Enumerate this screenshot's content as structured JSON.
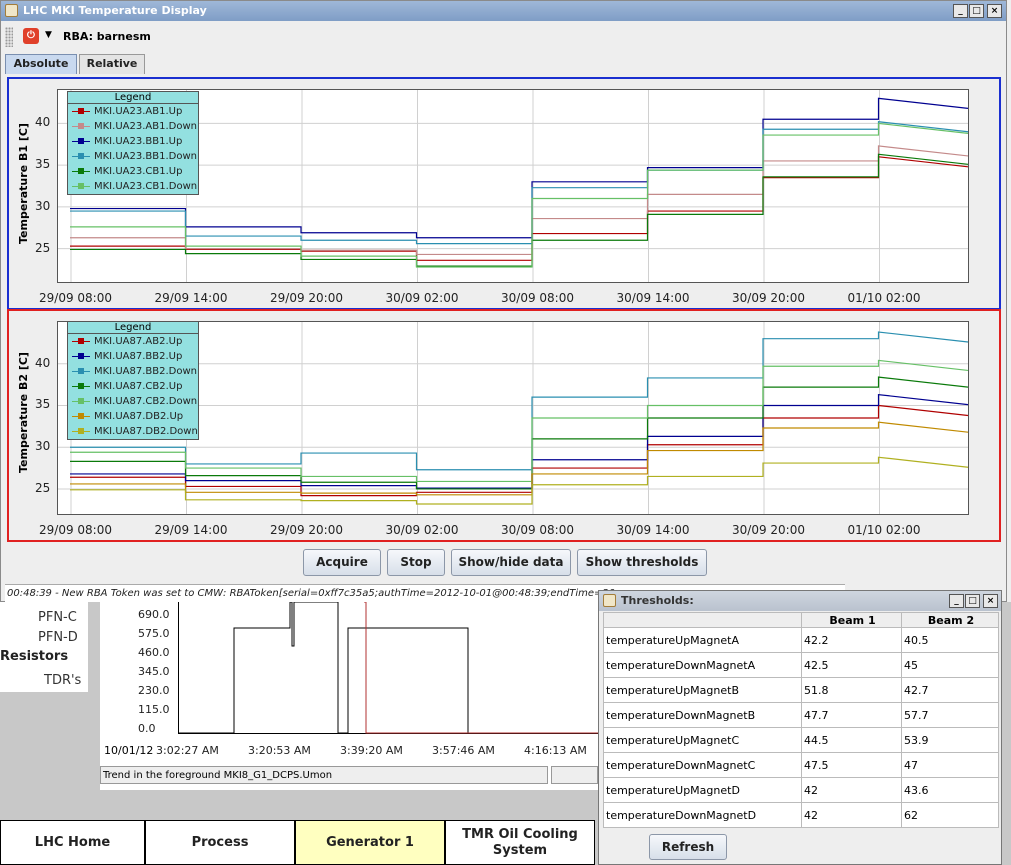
{
  "window": {
    "title": "LHC MKI Temperature Display"
  },
  "toolbar": {
    "rba_label": "RBA: barnesm"
  },
  "tabs": [
    {
      "label": "Absolute"
    },
    {
      "label": "Relative"
    }
  ],
  "charts": [
    {
      "ylabel": "Temperature B1  [C]",
      "yticks": [
        "40",
        "35",
        "30",
        "25"
      ],
      "xticks": [
        "29/09 08:00",
        "29/09 14:00",
        "29/09 20:00",
        "30/09 02:00",
        "30/09 08:00",
        "30/09 14:00",
        "30/09 20:00",
        "01/10 02:00"
      ],
      "legend_title": "Legend",
      "legend": [
        {
          "name": "MKI.UA23.AB1.Up",
          "color": "#b00000"
        },
        {
          "name": "MKI.UA23.AB1.Down",
          "color": "#c48a8a"
        },
        {
          "name": "MKI.UA23.BB1.Up",
          "color": "#000090"
        },
        {
          "name": "MKI.UA23.BB1.Down",
          "color": "#2a8fb0"
        },
        {
          "name": "MKI.UA23.CB1.Up",
          "color": "#0a7a0a"
        },
        {
          "name": "MKI.UA23.CB1.Down",
          "color": "#66c066"
        }
      ]
    },
    {
      "ylabel": "Temperature B2  [C]",
      "yticks": [
        "40",
        "35",
        "30",
        "25"
      ],
      "xticks": [
        "29/09 08:00",
        "29/09 14:00",
        "29/09 20:00",
        "30/09 02:00",
        "30/09 08:00",
        "30/09 14:00",
        "30/09 20:00",
        "01/10 02:00"
      ],
      "legend_title": "Legend",
      "legend": [
        {
          "name": "MKI.UA87.AB2.Up",
          "color": "#b00000"
        },
        {
          "name": "MKI.UA87.BB2.Up",
          "color": "#000090"
        },
        {
          "name": "MKI.UA87.BB2.Down",
          "color": "#2a8fb0"
        },
        {
          "name": "MKI.UA87.CB2.Up",
          "color": "#0a7a0a"
        },
        {
          "name": "MKI.UA87.CB2.Down",
          "color": "#66c066"
        },
        {
          "name": "MKI.UA87.DB2.Up",
          "color": "#c08a00"
        },
        {
          "name": "MKI.UA87.DB2.Down",
          "color": "#b0b020"
        }
      ]
    }
  ],
  "chart_data": [
    {
      "type": "line",
      "ylabel": "Temperature B1  [C]",
      "ylim": [
        21,
        44
      ],
      "x": [
        "29/09 08:00",
        "29/09 14:00",
        "29/09 20:00",
        "30/09 02:00",
        "30/09 08:00",
        "30/09 14:00",
        "30/09 20:00",
        "01/10 02:00"
      ],
      "series": [
        {
          "name": "MKI.UA23.AB1.Up",
          "values": [
            25.3,
            24.9,
            24.7,
            23.6,
            26.8,
            29.5,
            33.5,
            36.0
          ]
        },
        {
          "name": "MKI.UA23.AB1.Down",
          "values": [
            26.3,
            25.0,
            24.8,
            24.3,
            28.6,
            31.5,
            35.5,
            37.3
          ]
        },
        {
          "name": "MKI.UA23.BB1.Up",
          "values": [
            29.8,
            27.6,
            26.9,
            26.3,
            33.0,
            34.7,
            40.5,
            43.0
          ]
        },
        {
          "name": "MKI.UA23.BB1.Down",
          "values": [
            29.5,
            26.5,
            26.0,
            25.6,
            32.3,
            34.4,
            39.3,
            40.2
          ]
        },
        {
          "name": "MKI.UA23.CB1.Up",
          "values": [
            24.9,
            24.4,
            23.7,
            22.9,
            26.0,
            29.1,
            33.6,
            36.3
          ]
        },
        {
          "name": "MKI.UA23.CB1.Down",
          "values": [
            27.6,
            25.3,
            24.1,
            22.8,
            31.0,
            34.4,
            38.6,
            40.0
          ]
        }
      ]
    },
    {
      "type": "line",
      "ylabel": "Temperature B2  [C]",
      "ylim": [
        22,
        45
      ],
      "x": [
        "29/09 08:00",
        "29/09 14:00",
        "29/09 20:00",
        "30/09 02:00",
        "30/09 08:00",
        "30/09 14:00",
        "30/09 20:00",
        "01/10 02:00"
      ],
      "series": [
        {
          "name": "MKI.UA87.AB2.Up",
          "values": [
            26.4,
            25.3,
            24.2,
            24.6,
            27.5,
            30.3,
            33.5,
            35.0
          ]
        },
        {
          "name": "MKI.UA87.BB2.Up",
          "values": [
            26.8,
            26.0,
            25.4,
            25.1,
            28.5,
            31.3,
            35.0,
            36.3
          ]
        },
        {
          "name": "MKI.UA87.BB2.Down",
          "values": [
            30.0,
            28.0,
            29.3,
            27.3,
            36.0,
            38.3,
            43.0,
            43.8
          ]
        },
        {
          "name": "MKI.UA87.CB2.Up",
          "values": [
            28.3,
            26.6,
            25.8,
            25.0,
            31.0,
            33.5,
            37.2,
            38.4
          ]
        },
        {
          "name": "MKI.UA87.CB2.Down",
          "values": [
            29.4,
            27.5,
            26.5,
            25.9,
            33.5,
            35.0,
            39.7,
            40.4
          ]
        },
        {
          "name": "MKI.UA87.DB2.Up",
          "values": [
            25.6,
            24.6,
            24.5,
            24.3,
            26.8,
            29.6,
            32.3,
            33.0
          ]
        },
        {
          "name": "MKI.UA87.DB2.Down",
          "values": [
            24.9,
            23.7,
            23.6,
            23.2,
            25.5,
            26.5,
            28.1,
            28.8
          ]
        }
      ]
    }
  ],
  "buttons": {
    "acquire": "Acquire",
    "stop": "Stop",
    "show_hide": "Show/hide data",
    "show_thresholds": "Show thresholds"
  },
  "status": "00:48:39 - New RBA Token was set to CMW: RBAToken[serial=0xff7c35a5;authTime=2012-10-01@00:48:39;endTime=20",
  "background": {
    "labels": [
      "PFN-C",
      "PFN-D",
      "Resistors",
      "TDR's"
    ],
    "trend_yticks": [
      "690.0",
      "575.0",
      "460.0",
      "345.0",
      "230.0",
      "115.0",
      "0.0"
    ],
    "trend_date": "10/01/12",
    "trend_xticks": [
      "3:02:27 AM",
      "3:20:53 AM",
      "3:39:20 AM",
      "3:57:46 AM",
      "4:16:13 AM"
    ],
    "trend_caption": "Trend in the foreground MKI8_G1_DCPS.Umon",
    "nav": [
      "LHC Home",
      "Process",
      "Generator 1",
      "TMR Oil Cooling System"
    ]
  },
  "thresholds": {
    "title": "Thresholds:",
    "columns": [
      "",
      "Beam 1",
      "Beam 2"
    ],
    "rows": [
      [
        "temperatureUpMagnetA",
        "42.2",
        "40.5"
      ],
      [
        "temperatureDownMagnetA",
        "42.5",
        "45"
      ],
      [
        "temperatureUpMagnetB",
        "51.8",
        "42.7"
      ],
      [
        "temperatureDownMagnetB",
        "47.7",
        "57.7"
      ],
      [
        "temperatureUpMagnetC",
        "44.5",
        "53.9"
      ],
      [
        "temperatureDownMagnetC",
        "47.5",
        "47"
      ],
      [
        "temperatureUpMagnetD",
        "42",
        "43.6"
      ],
      [
        "temperatureDownMagnetD",
        "42",
        "62"
      ]
    ],
    "refresh": "Refresh"
  }
}
